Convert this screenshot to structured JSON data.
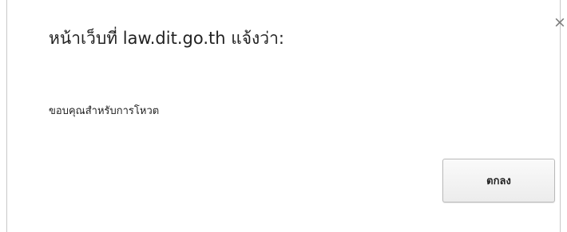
{
  "dialog": {
    "title": "หน้าเว็บที่ law.dit.go.th แจ้งว่า:",
    "message": "ขอบคุณสำหรับการโหวต",
    "ok_label": "ตกลง",
    "close_glyph": "×"
  }
}
